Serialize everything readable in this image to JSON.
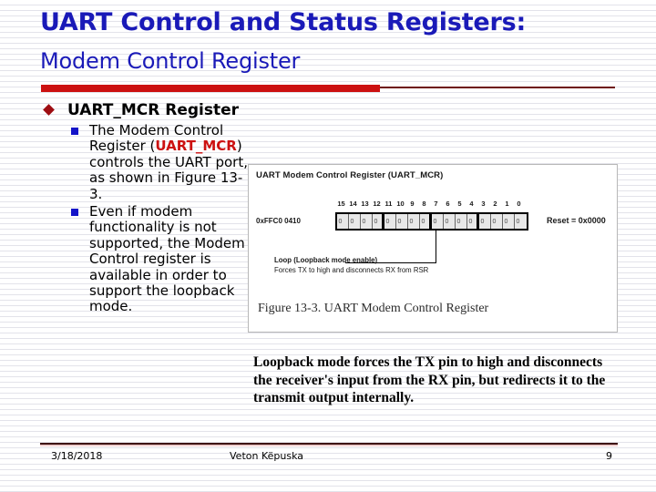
{
  "slide": {
    "title_main": "UART Control and Status Registers:",
    "title_sub": " Modem Control Register",
    "accent_red": "#cc1111",
    "title_blue": "#1a1ab8",
    "bullet_diamond_color": "#9e0d12",
    "bullet_square_color": "#1414c8"
  },
  "bullets": {
    "level1": "UART_MCR Register",
    "level2": [
      {
        "part1": "The Modem Control Register (",
        "highlight": "UART_MCR",
        "part2": ") controls the UART port, as shown in Figure 13-3."
      },
      {
        "text": "Even if modem functionality is not supported, the Modem Control register is available in order to support the loopback mode."
      }
    ]
  },
  "figure": {
    "register_title": "UART Modem Control Register (UART_MCR)",
    "address": "0xFFC0 0410",
    "reset": "Reset = 0x0000",
    "bit_labels": [
      "15",
      "14",
      "13",
      "12",
      "11",
      "10",
      "9",
      "8",
      "7",
      "6",
      "5",
      "4",
      "3",
      "2",
      "1",
      "0"
    ],
    "bit_values": [
      "0",
      "0",
      "0",
      "0",
      "0",
      "0",
      "0",
      "0",
      "0",
      "0",
      "0",
      "0",
      "0",
      "0",
      "0",
      "0"
    ],
    "callout_bold": "Loop (Loopback mode enable)",
    "callout_text": "Forces TX to high and disconnects RX from RSR",
    "caption": "Figure 13-3. UART Modem Control Register"
  },
  "emphasis": {
    "text": "Loopback mode forces the TX pin to high and disconnects the receiver's input from the RX pin, but redirects it to the transmit output internally."
  },
  "footer": {
    "date": "3/18/2018",
    "author": "Veton Këpuska",
    "page": "9"
  }
}
